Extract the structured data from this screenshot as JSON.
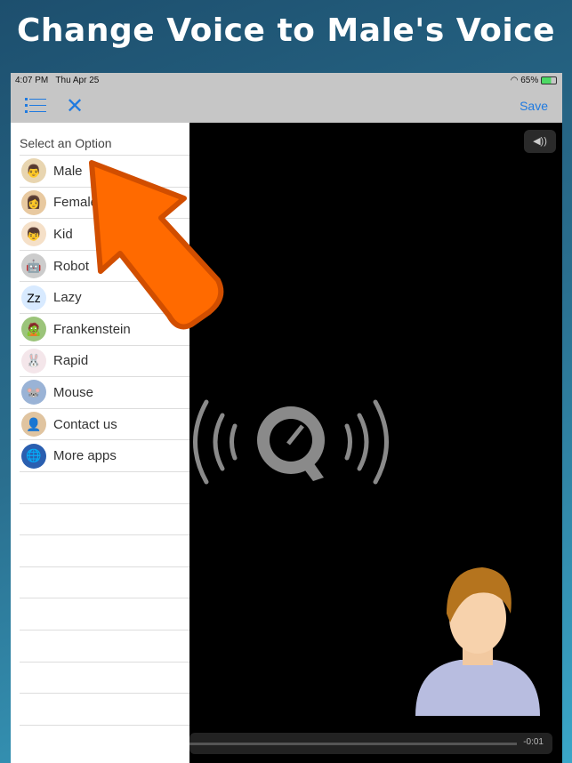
{
  "banner": {
    "title": "Change Voice to Male's Voice"
  },
  "status": {
    "time": "4:07 PM",
    "date": "Thu Apr 25",
    "battery": "65%"
  },
  "nav": {
    "close": "✕",
    "save": "Save"
  },
  "panel": {
    "heading": "Select an Option",
    "items": [
      {
        "label": "Male",
        "icon": "male-avatar",
        "glyph": "👨",
        "color": "#e8d5b0"
      },
      {
        "label": "Female",
        "icon": "female-avatar",
        "glyph": "👩",
        "color": "#e8c9a0"
      },
      {
        "label": "Kid",
        "icon": "kid-face",
        "glyph": "👦",
        "color": "#f5e0c8"
      },
      {
        "label": "Robot",
        "icon": "robot",
        "glyph": "🤖",
        "color": "#ccc"
      },
      {
        "label": "Lazy",
        "icon": "zzz",
        "glyph": "Zz",
        "color": "#d8eaff"
      },
      {
        "label": "Frankenstein",
        "icon": "frankenstein",
        "glyph": "🧟",
        "color": "#9bc47a"
      },
      {
        "label": "Rapid",
        "icon": "rabbit",
        "glyph": "🐰",
        "color": "#f4e6ea"
      },
      {
        "label": "Mouse",
        "icon": "mouse",
        "glyph": "🐭",
        "color": "#9ab3d6"
      },
      {
        "label": "Contact us",
        "icon": "contact-person",
        "glyph": "👤",
        "color": "#e0c4a0"
      },
      {
        "label": "More apps",
        "icon": "globe",
        "glyph": "🌐",
        "color": "#2a5fb0"
      }
    ]
  },
  "player": {
    "volume": "◀))",
    "time_remaining": "-0:01"
  },
  "colors": {
    "accent": "#1f7ae0",
    "arrow": "#ff6a00"
  }
}
